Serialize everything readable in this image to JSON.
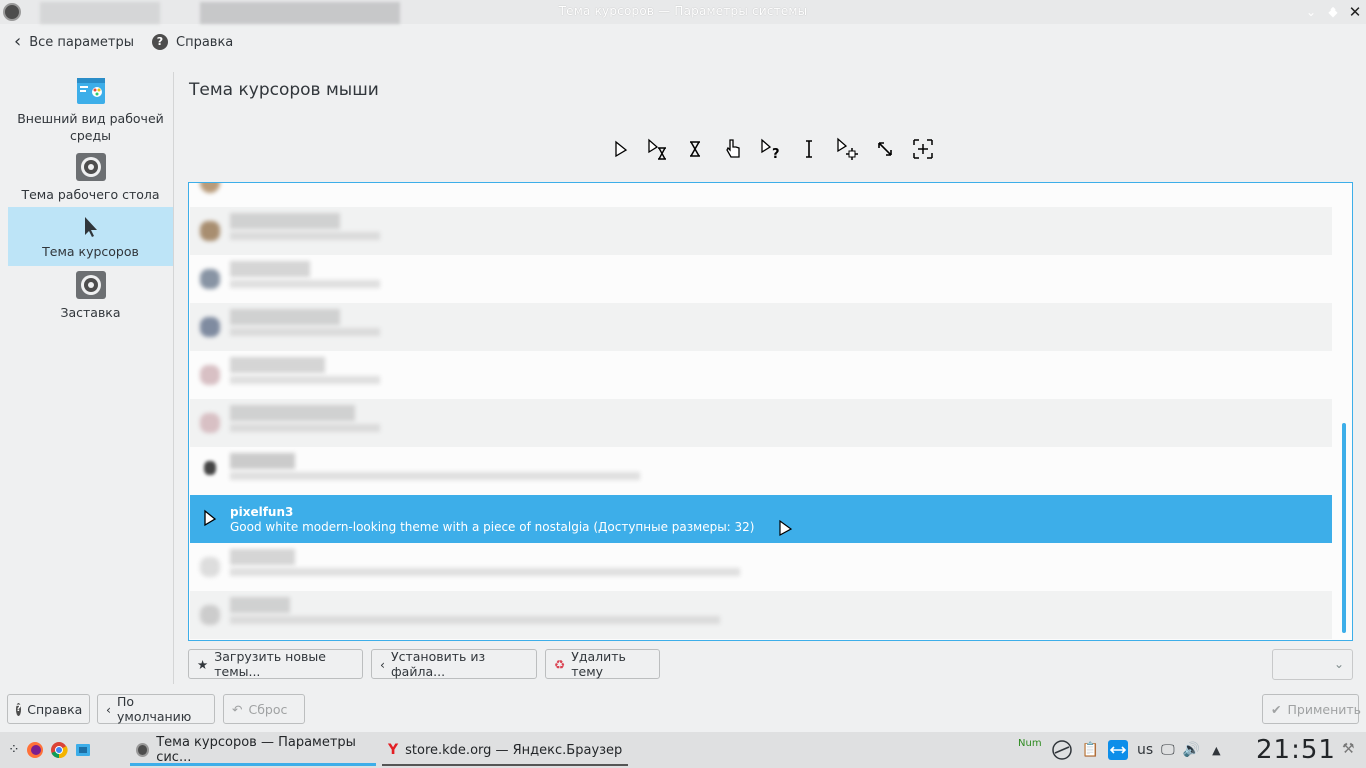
{
  "window": {
    "title": "Тема курсоров — Параметры системы"
  },
  "topnav": {
    "back_label": "Все параметры",
    "help_label": "Справка"
  },
  "sidebar": {
    "items": [
      {
        "label": "Внешний вид рабочей среды",
        "icon": "appearance-icon"
      },
      {
        "label": "Тема рабочего стола",
        "icon": "gear-icon"
      },
      {
        "label": "Тема курсоров",
        "icon": "cursor-icon",
        "active": true
      },
      {
        "label": "Заставка",
        "icon": "gear-icon"
      }
    ]
  },
  "main": {
    "title": "Тема курсоров мыши",
    "preview_cursors": [
      "arrow",
      "arrow-busy",
      "hourglass",
      "hand",
      "arrow-help",
      "ibeam",
      "arrow-move",
      "resize-diagonal",
      "crosshair"
    ]
  },
  "themes": {
    "selected": {
      "name": "pixelfun3",
      "description": "Good white modern-looking theme with a piece of nostalgia (Доступные размеры: 32)"
    }
  },
  "actions": {
    "download": "Загрузить новые темы...",
    "install": "Установить из файла...",
    "remove": "Удалить тему"
  },
  "footer": {
    "help": "Справка",
    "defaults": "По умолчанию",
    "reset": "Сброс",
    "apply": "Применить"
  },
  "taskbar": {
    "tasks": [
      {
        "label": "Тема курсоров — Параметры сис...",
        "active": true
      },
      {
        "label": "store.kde.org — Яндекс.Браузер",
        "active": false
      }
    ],
    "tray": {
      "numlock": "Num",
      "keyboard_layout": "us",
      "clock": "21:51"
    }
  },
  "colors": {
    "accent": "#3daee9",
    "selection_bg": "#bde4f7"
  }
}
